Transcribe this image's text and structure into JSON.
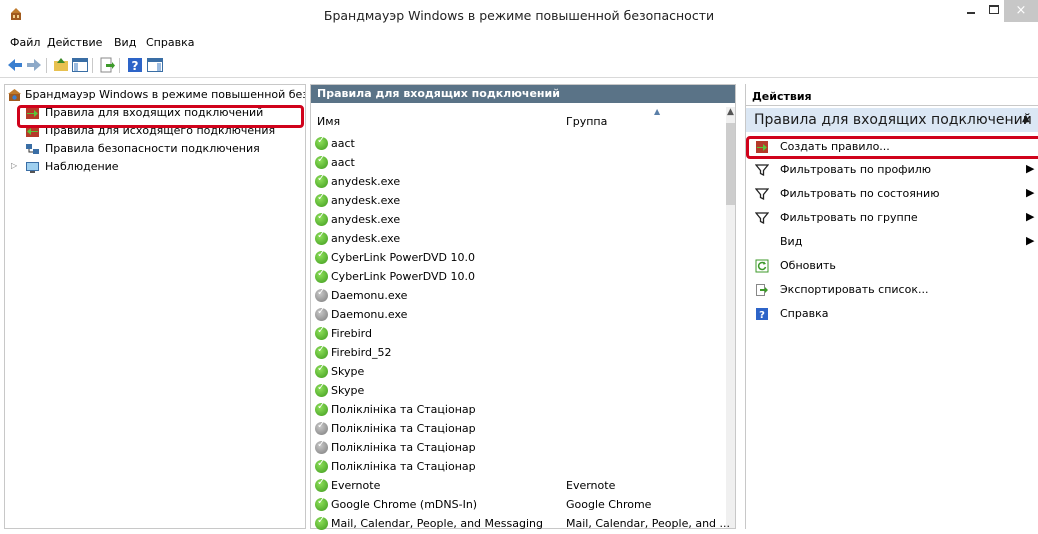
{
  "window": {
    "title": "Брандмауэр Windows в режиме повышенной безопасности",
    "minimize_icon": "minimize-icon",
    "maximize_icon": "maximize-icon",
    "close_icon": "close-icon",
    "close_glyph": "×"
  },
  "menu": [
    "Файл",
    "Действие",
    "Вид",
    "Справка"
  ],
  "tree": {
    "root": "Брандмауэр Windows в режиме повышенной без",
    "items": [
      {
        "label": "Правила для входящих подключений",
        "icon": "inbound-rules-icon"
      },
      {
        "label": "Правила для исходящего подключения",
        "icon": "outbound-rules-icon"
      },
      {
        "label": "Правила безопасности подключения",
        "icon": "connection-security-icon"
      },
      {
        "label": "Наблюдение",
        "icon": "monitoring-icon"
      }
    ]
  },
  "rules_pane": {
    "header": "Правила для входящих подключений",
    "columns": {
      "name": "Имя",
      "group": "Группа"
    },
    "rows": [
      {
        "name": "aact",
        "group": "",
        "enabled": true
      },
      {
        "name": "aact",
        "group": "",
        "enabled": true
      },
      {
        "name": "anydesk.exe",
        "group": "",
        "enabled": true
      },
      {
        "name": "anydesk.exe",
        "group": "",
        "enabled": true
      },
      {
        "name": "anydesk.exe",
        "group": "",
        "enabled": true
      },
      {
        "name": "anydesk.exe",
        "group": "",
        "enabled": true
      },
      {
        "name": "CyberLink PowerDVD 10.0",
        "group": "",
        "enabled": true
      },
      {
        "name": "CyberLink PowerDVD 10.0",
        "group": "",
        "enabled": true
      },
      {
        "name": "Daemonu.exe",
        "group": "",
        "enabled": false
      },
      {
        "name": "Daemonu.exe",
        "group": "",
        "enabled": false
      },
      {
        "name": "Firebird",
        "group": "",
        "enabled": true
      },
      {
        "name": "Firebird_52",
        "group": "",
        "enabled": true
      },
      {
        "name": "Skype",
        "group": "",
        "enabled": true
      },
      {
        "name": "Skype",
        "group": "",
        "enabled": true
      },
      {
        "name": "Поліклініка та Стаціонар",
        "group": "",
        "enabled": true
      },
      {
        "name": "Поліклініка та Стаціонар",
        "group": "",
        "enabled": false
      },
      {
        "name": "Поліклініка та Стаціонар",
        "group": "",
        "enabled": false
      },
      {
        "name": "Поліклініка та Стаціонар",
        "group": "",
        "enabled": true
      },
      {
        "name": "Evernote",
        "group": "Evernote",
        "enabled": true
      },
      {
        "name": "Google Chrome (mDNS-In)",
        "group": "Google Chrome",
        "enabled": true
      },
      {
        "name": "Mail, Calendar, People, and Messaging",
        "group": "Mail, Calendar, People, and ...",
        "enabled": true
      }
    ]
  },
  "actions": {
    "header": "Действия",
    "section": "Правила для входящих подключений",
    "section_arrow": "▲",
    "items": [
      {
        "label": "Создать правило...",
        "icon": "new-rule-icon",
        "submenu": false
      },
      {
        "label": "Фильтровать по профилю",
        "icon": "filter-icon",
        "submenu": true
      },
      {
        "label": "Фильтровать по состоянию",
        "icon": "filter-icon",
        "submenu": true
      },
      {
        "label": "Фильтровать по группе",
        "icon": "filter-icon",
        "submenu": true
      },
      {
        "label": "Вид",
        "icon": "",
        "submenu": true
      },
      {
        "label": "Обновить",
        "icon": "refresh-icon",
        "submenu": false
      },
      {
        "label": "Экспортировать список...",
        "icon": "export-icon",
        "submenu": false
      },
      {
        "label": "Справка",
        "icon": "help-icon",
        "submenu": false
      }
    ],
    "submenu_glyph": "▶"
  },
  "colors": {
    "highlight_box": "#d0021b",
    "pane_header": "#5a7387",
    "section_bg": "#dbe7f4"
  }
}
